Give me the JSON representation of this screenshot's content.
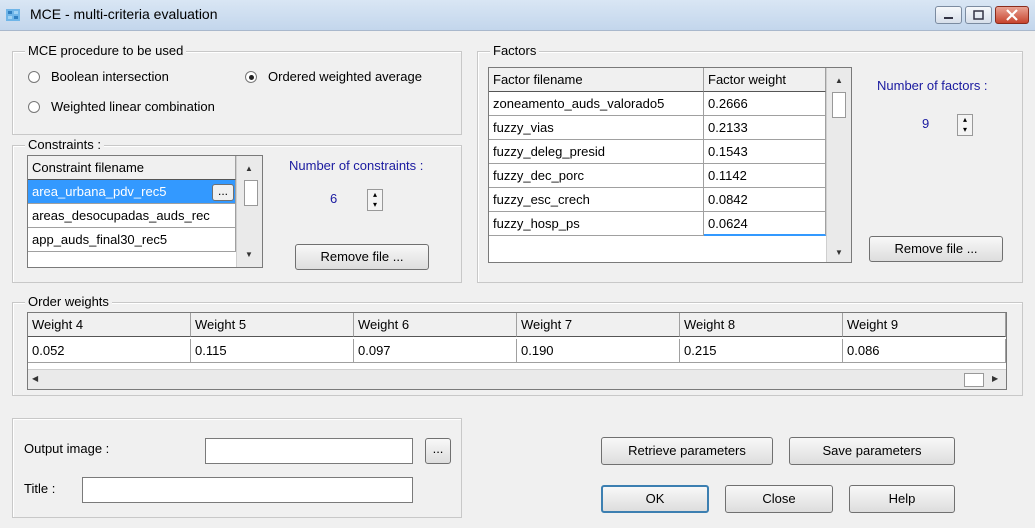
{
  "window": {
    "title": "MCE - multi-criteria evaluation"
  },
  "procedure": {
    "legend": "MCE procedure to be used",
    "options": [
      "Boolean intersection",
      "Ordered weighted average",
      "Weighted linear combination"
    ],
    "selected": "Ordered weighted average"
  },
  "constraints": {
    "legend": "Constraints :",
    "header": "Constraint filename",
    "files": [
      "area_urbana_pdv_rec5",
      "areas_desocupadas_auds_rec",
      "app_auds_final30_rec5"
    ],
    "count_label": "Number of constraints :",
    "count": "6",
    "remove_label": "Remove file ...",
    "browse_label": "..."
  },
  "factors": {
    "legend": "Factors",
    "headers": [
      "Factor filename",
      "Factor weight"
    ],
    "rows": [
      {
        "name": "zoneamento_auds_valorado5",
        "weight": "0.2666"
      },
      {
        "name": "fuzzy_vias",
        "weight": "0.2133"
      },
      {
        "name": "fuzzy_deleg_presid",
        "weight": "0.1543"
      },
      {
        "name": "fuzzy_dec_porc",
        "weight": "0.1142"
      },
      {
        "name": "fuzzy_esc_crech",
        "weight": "0.0842"
      },
      {
        "name": "fuzzy_hosp_ps",
        "weight": "0.0624"
      }
    ],
    "count_label": "Number of factors :",
    "count": "9",
    "remove_label": "Remove file ..."
  },
  "order_weights": {
    "legend": "Order weights",
    "headers": [
      "Weight 4",
      "Weight 5",
      "Weight 6",
      "Weight 7",
      "Weight 8",
      "Weight 9"
    ],
    "values": [
      "0.052",
      "0.115",
      "0.097",
      "0.190",
      "0.215",
      "0.086"
    ]
  },
  "output": {
    "image_label": "Output image :",
    "image_value": "",
    "browse_label": "...",
    "title_label": "Title :",
    "title_value": ""
  },
  "buttons": {
    "retrieve": "Retrieve parameters",
    "save": "Save parameters",
    "ok": "OK",
    "close": "Close",
    "help": "Help"
  },
  "colors": {
    "selection": "#3399ff",
    "titlebar": "#c3d6ec",
    "close_button": "#c7442e"
  }
}
